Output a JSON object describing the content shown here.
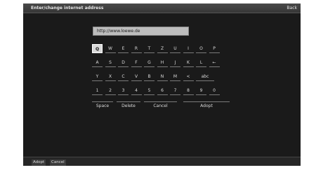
{
  "dialog": {
    "title": "Enter/change internet address",
    "back_label": "Back"
  },
  "url_input": {
    "value": "http://www.loewe.de"
  },
  "keyboard": {
    "selected_key": "Q",
    "rows": [
      [
        "Q",
        "W",
        "E",
        "R",
        "T",
        "Z",
        "U",
        "I",
        "O",
        "P"
      ],
      [
        "A",
        "S",
        "D",
        "F",
        "G",
        "H",
        "J",
        "K",
        "L",
        "←"
      ],
      [
        "Y",
        "X",
        "C",
        "V",
        "B",
        "N",
        "M",
        "<",
        "abc"
      ],
      [
        "1",
        "2",
        "3",
        "4",
        "5",
        "6",
        "7",
        "8",
        "9",
        "0"
      ]
    ],
    "bottom_row": [
      "Space",
      "Delete",
      "Cancel",
      "Adopt"
    ]
  },
  "footer": {
    "buttons": [
      "Adopt",
      "Cancel"
    ]
  },
  "colors": {
    "background": "#1a1a1a",
    "title_bar": "#3e3e3e",
    "selected_key": "#d9d9d9",
    "input_field": "#bdbdbd"
  }
}
